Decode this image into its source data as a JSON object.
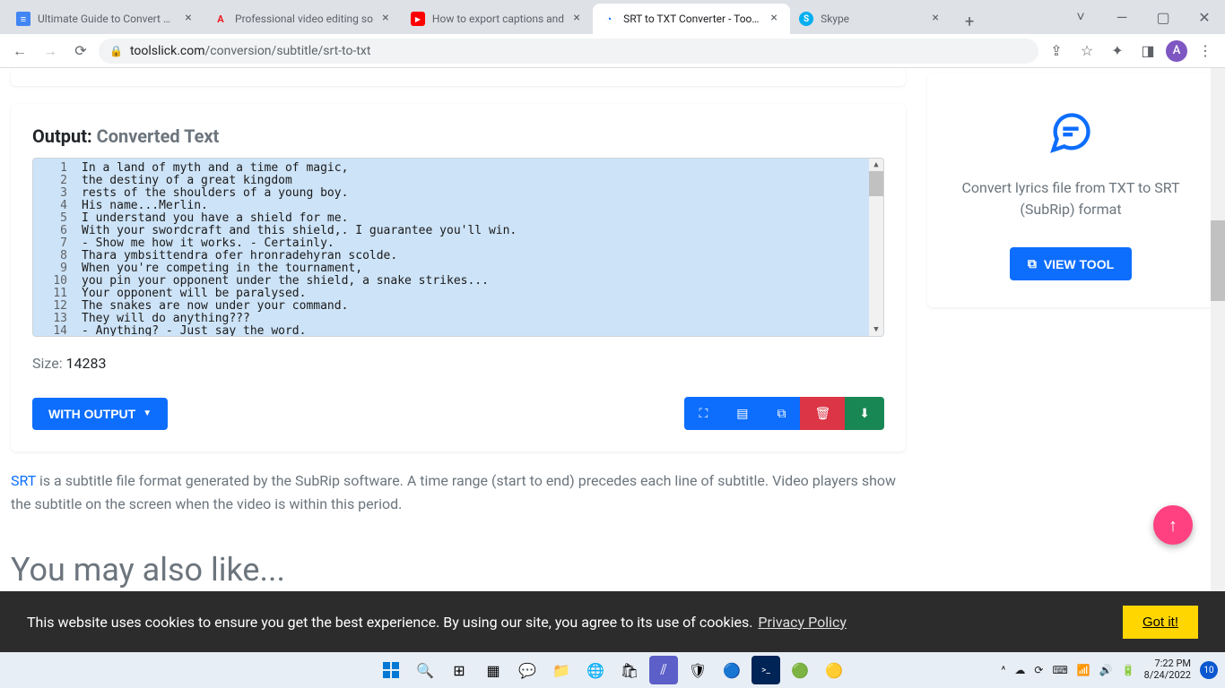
{
  "tabs": [
    {
      "title": "Ultimate Guide to Convert SR",
      "favicon_bg": "#4285f4",
      "favicon_char": "≡"
    },
    {
      "title": "Professional video editing so",
      "favicon_bg": "#ed1c24",
      "favicon_char": "A"
    },
    {
      "title": "How to export captions and",
      "favicon_bg": "#ff0000",
      "favicon_char": "▶"
    },
    {
      "title": "SRT to TXT Converter - Tool S",
      "favicon_bg": "#0d6efd",
      "favicon_char": "●",
      "active": true
    },
    {
      "title": "Skype",
      "favicon_bg": "#00aff0",
      "favicon_char": "S"
    }
  ],
  "addressbar": {
    "domain": "toolslick.com",
    "path": "/conversion/subtitle/srt-to-txt"
  },
  "profile_initial": "A",
  "output": {
    "heading_label": "Output:",
    "heading_sub": "Converted Text",
    "lines": [
      "In a land of myth and a time of magic,",
      "the destiny of a great kingdom",
      "rests of the shoulders of a young boy.",
      "His name...Merlin.",
      "I understand you have a shield for me.",
      "With your swordcraft and this shield,. I guarantee you'll win.",
      "- Show me how it works. - Certainly.",
      "Thara ymbsittendra ofer hronradehyran scolde.",
      "When you're competing in the tournament,",
      "you pin your opponent under the shield, a snake strikes...",
      "Your opponent will be paralysed.",
      "The snakes are now under your command.",
      "They will do anything???",
      "- Anything? - Just say the word."
    ],
    "size_label": "Size:",
    "size_value": "14283",
    "with_output_label": "WITH OUTPUT"
  },
  "description": {
    "srt_link": "SRT",
    "text": " is a subtitle file format generated by the SubRip software. A time range (start to end) precedes each line of subtitle. Video players show the subtitle on the screen when the video is within this period."
  },
  "also_like_heading": "You may also like...",
  "sidebar": {
    "desc": "Convert lyrics file from TXT to SRT (SubRip) format",
    "view_tool_label": "VIEW TOOL"
  },
  "cookie": {
    "text": "This website uses cookies to ensure you get the best experience. By using our site, you agree to its use of cookies.",
    "privacy_label": "Privacy Policy",
    "gotit_label": "Got it!"
  },
  "taskbar": {
    "time": "7:22 PM",
    "date": "8/24/2022",
    "notif_count": "10"
  }
}
